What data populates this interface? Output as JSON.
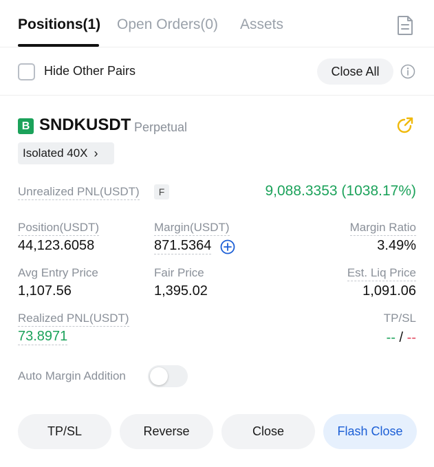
{
  "tabs": [
    {
      "label": "Positions(1)",
      "active": true
    },
    {
      "label": "Open Orders(0)",
      "active": false
    },
    {
      "label": "Assets",
      "active": false
    }
  ],
  "header_icons": {
    "history": "document-icon"
  },
  "filter": {
    "hide_other_pairs_label": "Hide Other Pairs",
    "hide_other_pairs_checked": false,
    "close_all_label": "Close All",
    "info_icon": "info-icon"
  },
  "position": {
    "side_badge": "B",
    "symbol": "SNDKUSDT",
    "contract_type": "Perpetual",
    "share_icon": "share-icon",
    "margin_mode": "Isolated 40X",
    "unrealized_pnl_label": "Unrealized PNL(USDT)",
    "unrealized_pnl_badge": "F",
    "unrealized_pnl_value": "9,088.3353 (1038.17%)",
    "position_label": "Position(USDT)",
    "position_value": "44,123.6058",
    "margin_label": "Margin(USDT)",
    "margin_value": "871.5364",
    "margin_ratio_label": "Margin Ratio",
    "margin_ratio_value": "3.49%",
    "avg_entry_label": "Avg Entry Price",
    "avg_entry_value": "1,107.56",
    "fair_price_label": "Fair Price",
    "fair_price_value": "1,395.02",
    "liq_price_label": "Est. Liq Price",
    "liq_price_value": "1,091.06",
    "realized_pnl_label": "Realized PNL(USDT)",
    "realized_pnl_value": "73.8971",
    "tpsl_label": "TP/SL",
    "tp_value": "--",
    "tpsl_separator": "/",
    "sl_value": "--",
    "auto_margin_label": "Auto Margin Addition",
    "auto_margin_enabled": false
  },
  "actions": {
    "tpsl": "TP/SL",
    "reverse": "Reverse",
    "close": "Close",
    "flash_close": "Flash Close"
  },
  "colors": {
    "profit_green": "#1ba25a",
    "loss_red": "#e0465e",
    "accent_blue": "#1c5fd6",
    "badge_green": "#1ba25a",
    "share_icon_orange": "#f0b90b"
  }
}
